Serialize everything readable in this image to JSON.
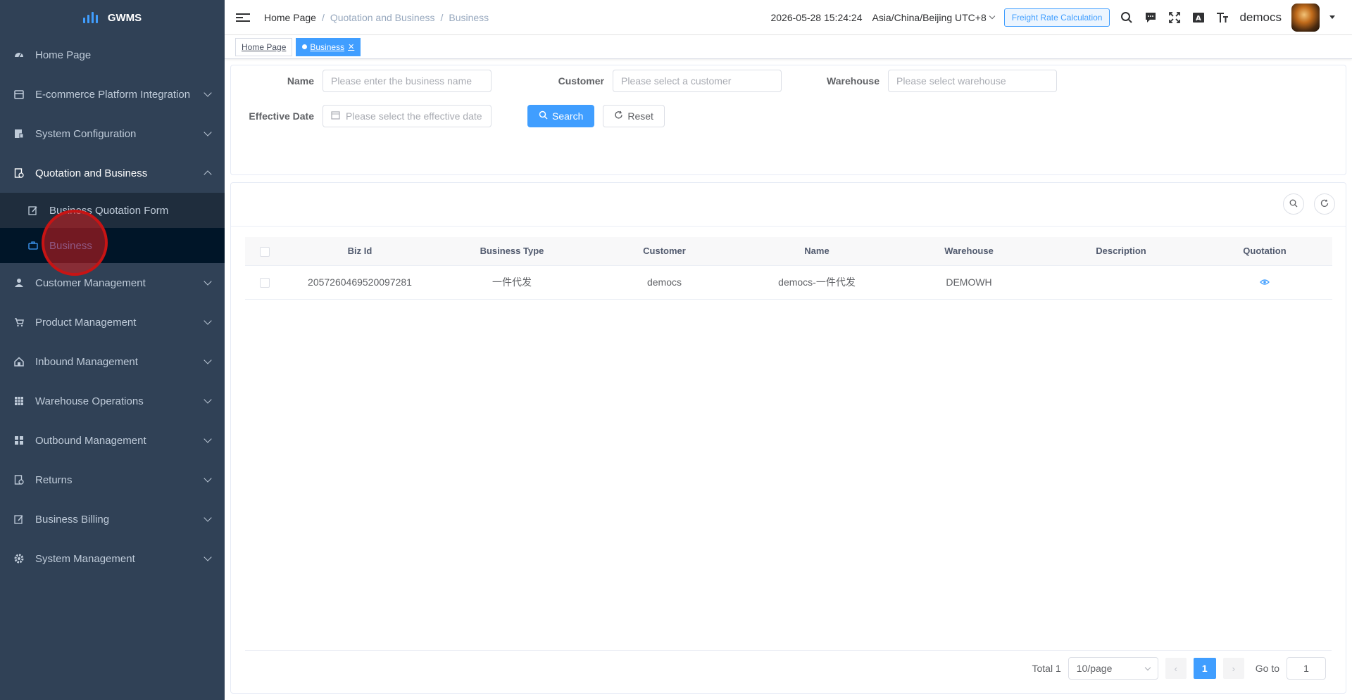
{
  "app": {
    "title": "GWMS"
  },
  "sidebar": {
    "items": [
      {
        "label": "Home Page",
        "icon": "dashboard-icon",
        "expandable": false
      },
      {
        "label": "E-commerce Platform Integration",
        "icon": "store-icon",
        "expandable": true
      },
      {
        "label": "System Configuration",
        "icon": "config-icon",
        "expandable": true
      },
      {
        "label": "Quotation and Business",
        "icon": "quotation-icon",
        "expandable": true,
        "open": true
      },
      {
        "label": "Customer Management",
        "icon": "user-icon",
        "expandable": true
      },
      {
        "label": "Product Management",
        "icon": "cart-icon",
        "expandable": true
      },
      {
        "label": "Inbound Management",
        "icon": "home-icon",
        "expandable": true
      },
      {
        "label": "Warehouse Operations",
        "icon": "grid-icon",
        "expandable": true
      },
      {
        "label": "Outbound Management",
        "icon": "apps-icon",
        "expandable": true
      },
      {
        "label": "Returns",
        "icon": "returns-icon",
        "expandable": true
      },
      {
        "label": "Business Billing",
        "icon": "billing-icon",
        "expandable": true
      },
      {
        "label": "System Management",
        "icon": "gear-icon",
        "expandable": true
      }
    ],
    "submenu": [
      {
        "label": "Business Quotation Form",
        "icon": "edit-icon"
      },
      {
        "label": "Business",
        "icon": "briefcase-icon",
        "active": true
      }
    ]
  },
  "header": {
    "breadcrumb": [
      "Home Page",
      "Quotation and Business",
      "Business"
    ],
    "datetime": "2026-05-28 15:24:24",
    "timezone": "Asia/China/Beijing UTC+8",
    "freight_button": "Freight Rate Calculation",
    "username": "democs"
  },
  "tags": [
    {
      "label": "Home Page",
      "active": false
    },
    {
      "label": "Business",
      "active": true
    }
  ],
  "search": {
    "name_label": "Name",
    "name_placeholder": "Please enter the business name",
    "customer_label": "Customer",
    "customer_placeholder": "Please select a customer",
    "warehouse_label": "Warehouse",
    "warehouse_placeholder": "Please select warehouse",
    "date_label": "Effective Date",
    "date_placeholder": "Please select the effective date",
    "search_button": "Search",
    "reset_button": "Reset"
  },
  "table": {
    "columns": [
      "Biz Id",
      "Business Type",
      "Customer",
      "Name",
      "Warehouse",
      "Description",
      "Quotation"
    ],
    "rows": [
      {
        "biz_id": "2057260469520097281",
        "business_type": "一件代发",
        "customer": "democs",
        "name": "democs-一件代发",
        "warehouse": "DEMOWH",
        "description": ""
      }
    ]
  },
  "pagination": {
    "total": "Total 1",
    "page_size": "10/page",
    "current_page": "1",
    "goto_label": "Go to",
    "goto_value": "1"
  },
  "colors": {
    "sidebar_bg": "#304156",
    "accent": "#409eff",
    "active_sub_bg": "#001528"
  }
}
